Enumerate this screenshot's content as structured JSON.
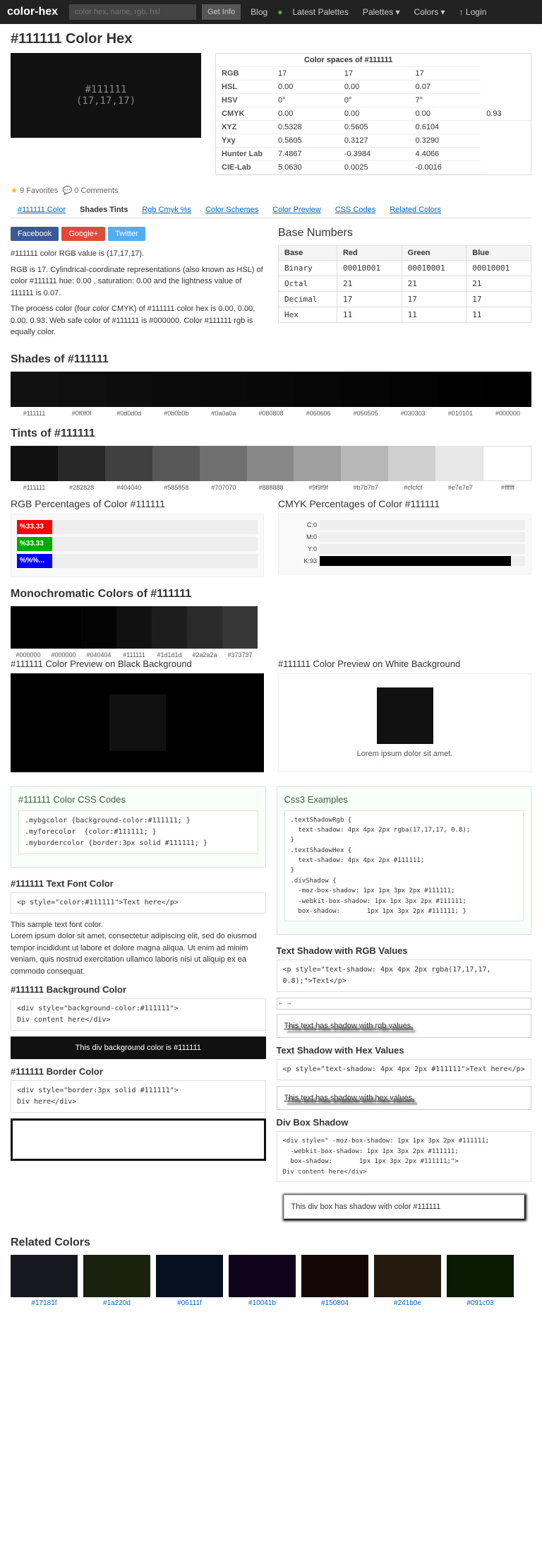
{
  "header": {
    "logo": "color-hex",
    "search_placeholder": "color hex, name, rgb, hsl",
    "get_info_btn": "Get Info",
    "blog_link": "Blog",
    "latest_palettes": "Latest Palettes",
    "palettes_dropdown": "Palettes ▾",
    "colors_dropdown": "Colors ▾",
    "login_link": "↑ Login"
  },
  "page": {
    "title": "#111111 Color Hex",
    "color_value": "#111111",
    "color_rgb": "(17,17,17)",
    "favorites_count": "9 Favorites",
    "comments_count": "0 Comments",
    "color_spaces_title": "Color spaces of #111111"
  },
  "color_spaces": {
    "rows": [
      {
        "label": "RGB",
        "v1": "17",
        "v2": "17",
        "v3": "17"
      },
      {
        "label": "HSL",
        "v1": "0.00",
        "v2": "0.00",
        "v3": "0.07"
      },
      {
        "label": "HSV",
        "v1": "0°",
        "v2": "0°",
        "v3": "7°"
      },
      {
        "label": "CMYK",
        "v1": "0.00",
        "v2": "0.00",
        "v3": "0.00",
        "v4": "0.93"
      },
      {
        "label": "XYZ",
        "v1": "0.5328",
        "v2": "0.5605",
        "v3": "0.6104"
      },
      {
        "label": "Yxy",
        "v1": "0.5605",
        "v2": "0.3127",
        "v3": "0.3290"
      },
      {
        "label": "Hunter Lab",
        "v1": "7.4867",
        "v2": "-0.3984",
        "v3": "4.4066"
      },
      {
        "label": "CIE-Lab",
        "v1": "5.0630",
        "v2": "0.0025",
        "v3": "-0.0016"
      }
    ]
  },
  "tabs": [
    {
      "label": "#111111 Color",
      "active": false
    },
    {
      "label": "Shades Tints",
      "active": true
    },
    {
      "label": "Rgb Cmyk %s",
      "active": false
    },
    {
      "label": "Color Schemes",
      "active": false
    },
    {
      "label": "Color Preview",
      "active": false
    },
    {
      "label": "CSS Codes",
      "active": false
    },
    {
      "label": "Related Colors",
      "active": false
    }
  ],
  "social": {
    "facebook": "Facebook",
    "google": "Google+",
    "twitter": "Twitter"
  },
  "color_info": {
    "rgb_line": "#111111 color RGB value is (17,17,17).",
    "hsl_desc": "RGB is 17. Cylindrical-coordinate representations (also known as HSL) of color #111111 hue: 0.00 , saturation: 0.00 and the lightness value of 111111 is 0.07.",
    "process_desc": "The process color (four color CMYK) of #111111 color hex is 0.00, 0.00, 0.00, 0.93. Web safe color of #111111 is #000000. Color #111111 rgb is equally color."
  },
  "base_numbers": {
    "title": "Base Numbers",
    "headers": [
      "Base",
      "Red",
      "Green",
      "Blue"
    ],
    "rows": [
      {
        "base": "Binary",
        "red": "00010001",
        "green": "00010001",
        "blue": "00010001"
      },
      {
        "base": "Octal",
        "red": "21",
        "green": "21",
        "blue": "21"
      },
      {
        "base": "Decimal",
        "red": "17",
        "green": "17",
        "blue": "17"
      },
      {
        "base": "Hex",
        "red": "11",
        "green": "11",
        "blue": "11"
      }
    ]
  },
  "shades": {
    "title": "Shades of #111111",
    "colors": [
      {
        "hex": "#111111",
        "bg": "#111111"
      },
      {
        "hex": "#0f0f0f",
        "bg": "#0f0f0f"
      },
      {
        "hex": "#0d0d0d",
        "bg": "#0d0d0d"
      },
      {
        "hex": "#0b0b0b",
        "bg": "#0b0b0b"
      },
      {
        "hex": "#0a0a0a",
        "bg": "#0a0a0a"
      },
      {
        "hex": "#080808",
        "bg": "#080808"
      },
      {
        "hex": "#060606",
        "bg": "#060606"
      },
      {
        "hex": "#050505",
        "bg": "#050505"
      },
      {
        "hex": "#030303",
        "bg": "#030303"
      },
      {
        "hex": "#010101",
        "bg": "#010101"
      },
      {
        "hex": "#000000",
        "bg": "#000000"
      }
    ]
  },
  "tints": {
    "title": "Tints of #111111",
    "colors": [
      {
        "hex": "#111111",
        "bg": "#111111"
      },
      {
        "hex": "#282828",
        "bg": "#282828"
      },
      {
        "hex": "#404040",
        "bg": "#404040"
      },
      {
        "hex": "#585858",
        "bg": "#585858"
      },
      {
        "hex": "#707070",
        "bg": "#707070"
      },
      {
        "hex": "#888888",
        "bg": "#888888"
      },
      {
        "hex": "#9f9f9f",
        "bg": "#9f9f9f"
      },
      {
        "hex": "#b7b7b7",
        "bg": "#b7b7b7"
      },
      {
        "hex": "#cfcfcf",
        "bg": "#cfcfcf"
      },
      {
        "hex": "#e7e7e7",
        "bg": "#e7e7e7"
      },
      {
        "hex": "#ffffff",
        "bg": "#ffffff"
      }
    ]
  },
  "rgb_percentages": {
    "title": "RGB Percentages of Color #111111",
    "bars": [
      {
        "label": "%33.33",
        "color": "#ff0000",
        "pct": 33.33
      },
      {
        "label": "%33.33",
        "color": "#00aa00",
        "pct": 33.33
      },
      {
        "label": "%%%...",
        "color": "#0000ff",
        "pct": 33.33
      }
    ]
  },
  "cmyk_percentages": {
    "title": "CMYK Percentages of Color #111111",
    "bars": [
      {
        "label": "C:0",
        "color": "#00bcd4",
        "pct": 0
      },
      {
        "label": "M:0",
        "color": "#e91e8c",
        "pct": 0
      },
      {
        "label": "Y:0",
        "color": "#ffeb3b",
        "pct": 0
      },
      {
        "label": "K:93",
        "color": "#000000",
        "pct": 93
      }
    ]
  },
  "monochromatic": {
    "title": "Monochromatic Colors of #111111",
    "colors": [
      {
        "hex": "#000000",
        "bg": "#000000"
      },
      {
        "hex": "#000000",
        "bg": "#000000"
      },
      {
        "hex": "#040404",
        "bg": "#040404"
      },
      {
        "hex": "#111111",
        "bg": "#111111"
      },
      {
        "hex": "#1d1d1d",
        "bg": "#1d1d1d"
      },
      {
        "hex": "#2a2a2a",
        "bg": "#2a2a2a"
      },
      {
        "hex": "#373737",
        "bg": "#373737"
      }
    ]
  },
  "previews": {
    "black_title": "#111111 Color Preview on Black Background",
    "white_title": "#111111 Color Preview on White Background",
    "lorem": "Lorem ipsum dolor sit amet."
  },
  "css_codes": {
    "section_title": "#111111 Color CSS Codes",
    "code1": ".mybgcolor {background-color:#111111; }\n.myforecolor  {color:#111111; }\n.mybordercolor {border:3px solid #111111; }",
    "font_title": "#111111 Text Font Color",
    "font_code": "<p style=\"color:#111111\">Text here</p>",
    "font_desc": "This sample text font color.\nLorem ipsum dolor sit amet, consectetur adipiscing elit, sed do eiusmod tempor incididunt ut labore et dolore magna aliqua. Ut enim ad minim veniam, quis nostrud exercitation ullamco laboris nisi ut aliquip ex ea commodo consequat.",
    "bg_title": "#111111 Background Color",
    "bg_code": "<div style=\"background-color:#111111\">\nDiv content here</div>",
    "bg_preview": "This div background color is #111111",
    "border_title": "#111111 Border Color",
    "border_code": "<div style=\"border:3px solid #111111\">\nDiv here</div>"
  },
  "css3_examples": {
    "section_title": "Css3 Examples",
    "code_block": ".textShadowRgb {\n  text-shadow: 4px 4px 2px rgba(17,17,17, 0.8);\n}\n.textShadowHex {\n  text-shadow: 4px 4px 2px #111111;\n}\n.divShadow {\n  -moz-box-shadow: 1px 1px 3px 2px #111111;\n  -webkit-box-shadow: 1px 1px 3px 2px #111111;\n  box-shadow:       1px 1px 3px 2px #111111; }",
    "shadow_rgb_title": "Text Shadow with RGB Values",
    "shadow_rgb_code": "<p style=\"text-shadow: 4px 4px 2px rgba(17,17,17, 0.8);\">Text</p>",
    "shadow_rgb_preview": "This text has shadow with rgb values.",
    "shadow_hex_title": "Text Shadow with Hex Values",
    "shadow_hex_code": "<p style=\"text-shadow: 4px 4px 2px #111111\">Text here</p>",
    "shadow_hex_preview": "This text has shadow with hex values.",
    "box_shadow_title": "Div Box Shadow",
    "box_shadow_code": "<div style=\" -moz-box-shadow: 1px 1px 3px 2px #111111;\n  -webkit-box-shadow: 1px 1px 3px 2px #111111;\n  box-shadow:       1px 1px 3px 2px #111111;\">\nDiv content here</div>",
    "box_shadow_preview": "This div box has shadow with color #111111"
  },
  "related_colors": {
    "title": "Related Colors",
    "colors": [
      {
        "hex": "#17181f",
        "bg": "#17181f"
      },
      {
        "hex": "#1a220d",
        "bg": "#1a220d"
      },
      {
        "hex": "#06111f",
        "bg": "#06111f"
      },
      {
        "hex": "#10041b",
        "bg": "#10041b"
      },
      {
        "hex": "#150804",
        "bg": "#150804"
      },
      {
        "hex": "#241b0e",
        "bg": "#241b0e"
      },
      {
        "hex": "#091c03",
        "bg": "#091c03"
      }
    ]
  }
}
